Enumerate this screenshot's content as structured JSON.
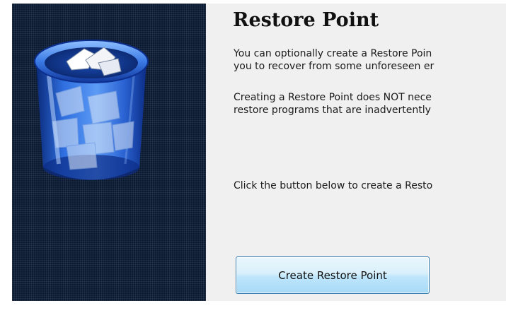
{
  "side_panel": {
    "icon": "recycle-bin-icon",
    "background_color": "#0b1a33"
  },
  "content": {
    "title": "Restore Point",
    "paragraph1": {
      "line1": "You can optionally create a Restore Poin",
      "line2": "you to recover from some unforeseen er"
    },
    "paragraph2": {
      "line1": "Creating a Restore Point does NOT nece",
      "line2": "restore programs that are inadvertently"
    },
    "paragraph3": "Click the button below to create a Resto"
  },
  "button": {
    "label": "Create Restore Point",
    "accent": "#bee6fd",
    "border": "#3c7fb1"
  }
}
